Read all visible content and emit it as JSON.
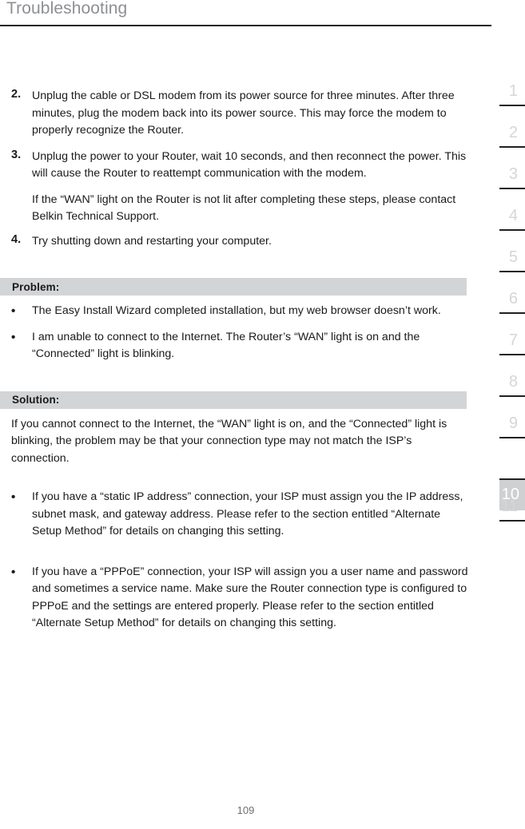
{
  "header": {
    "title": "Troubleshooting"
  },
  "content": {
    "steps": [
      {
        "marker": "2.",
        "text": "Unplug the cable or DSL modem from its power source for three minutes. After three minutes, plug the modem back into its power source. This may force the modem to properly recognize the Router."
      },
      {
        "marker": "3.",
        "text": "Unplug the power to your Router, wait 10 seconds, and then reconnect the power. This will cause the Router to reattempt communication with the modem."
      }
    ],
    "step3_note": "If the “WAN” light on the Router is not lit after completing these steps, please contact Belkin Technical Support.",
    "step4": {
      "marker": "4.",
      "text": "Try shutting down and restarting your computer."
    },
    "problem": {
      "banner_label": "Problem:",
      "bullet_char": "•",
      "items": [
        "The Easy Install Wizard completed installation, but my web browser doesn’t work.",
        "I am unable to connect to the Internet. The Router’s “WAN” light is on and the “Connected” light is blinking."
      ]
    },
    "solution": {
      "banner_label": "Solution:",
      "intro": "If you cannot connect to the Internet, the “WAN” light is on, and the “Connected” light is blinking, the problem may be that your connection type may not match the ISP’s connection.",
      "bullet_char": "•",
      "items": [
        "If you have a “static IP address” connection, your ISP must assign you the IP address, subnet mask, and gateway address. Please refer to the section entitled “Alternate Setup Method” for details on changing this setting.",
        "If you have a “PPPoE” connection, your ISP will assign you a user name and password and sometimes a service name. Make sure the Router connection type is configured to PPPoE and the settings are entered properly. Please refer to the section entitled “Alternate Setup Method” for details on changing this setting."
      ]
    }
  },
  "tab_strip": {
    "tabs": [
      {
        "label": "1",
        "active": false
      },
      {
        "label": "2",
        "active": false
      },
      {
        "label": "3",
        "active": false
      },
      {
        "label": "4",
        "active": false
      },
      {
        "label": "5",
        "active": false
      },
      {
        "label": "6",
        "active": false
      },
      {
        "label": "7",
        "active": false
      },
      {
        "label": "8",
        "active": false
      },
      {
        "label": "9",
        "active": false
      },
      {
        "label": "10",
        "active": true
      },
      {
        "label": "11",
        "active": false
      }
    ]
  },
  "footer": {
    "page_number": "109"
  },
  "colors": {
    "header_text": "#8d8f93",
    "rule": "#231f20",
    "banner_background": "#d3d4d6",
    "tab_number": "#d5d6d8",
    "tab_active_background": "#cfd0d2",
    "body_text": "#1a1a1a"
  }
}
